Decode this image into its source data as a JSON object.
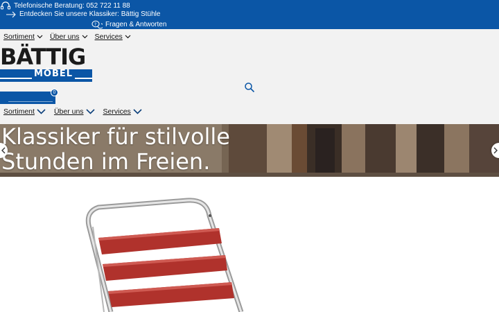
{
  "topbar": {
    "phone_text": "Telefonische Beratung: 052 722 11 88",
    "discover_text": "Entdecken Sie unsere Klassiker: Bättig Stühle",
    "faq_text": "Fragen & Antworten"
  },
  "nav_top": [
    {
      "label": "Sortiment"
    },
    {
      "label": "Über uns"
    },
    {
      "label": "Services"
    }
  ],
  "logo": {
    "brand": "BÄTTIG",
    "sub": "MÖBEL"
  },
  "cart": {
    "count": "0"
  },
  "nav_bottom": [
    {
      "label": "Sortiment"
    },
    {
      "label": "Über uns"
    },
    {
      "label": "Services"
    }
  ],
  "hero": {
    "line1": "Klassiker für stilvolle",
    "line2": "Stunden im Freien."
  },
  "colors": {
    "brand_blue": "#0b56a6",
    "nav_background": "#f2f2f2",
    "chair_red": "#b0322c"
  }
}
